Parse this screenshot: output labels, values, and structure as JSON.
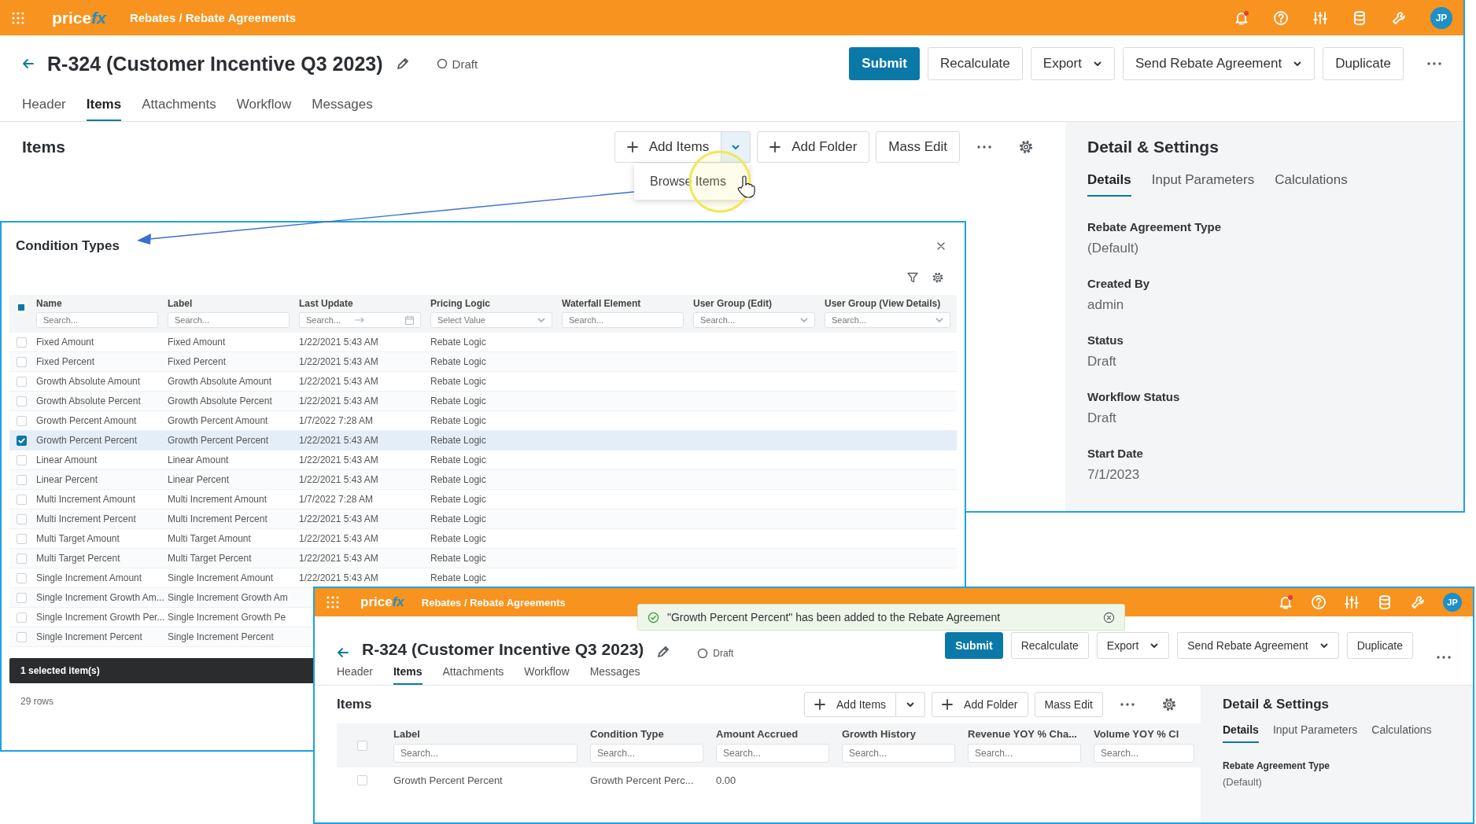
{
  "main": {
    "topbar": {
      "logo": {
        "word": "price",
        "accent": "fx"
      },
      "breadcrumb": "Rebates / Rebate Agreements",
      "notification": true,
      "avatar": "JP"
    },
    "header": {
      "title": "R-324 (Customer Incentive Q3 2023)",
      "status": "Draft",
      "actions": [
        {
          "label": "Submit",
          "kind": "primary"
        },
        {
          "label": "Recalculate",
          "kind": "plain"
        },
        {
          "label": "Export",
          "kind": "menu"
        },
        {
          "label": "Send Rebate Agreement",
          "kind": "menu"
        },
        {
          "label": "Duplicate",
          "kind": "plain"
        }
      ]
    },
    "tabs": [
      {
        "label": "Header",
        "selected": false
      },
      {
        "label": "Items",
        "selected": true
      },
      {
        "label": "Attachments",
        "selected": false
      },
      {
        "label": "Workflow",
        "selected": false
      },
      {
        "label": "Messages",
        "selected": false
      }
    ],
    "items": {
      "title": "Items",
      "toolbar": [
        {
          "label": "Add Items",
          "kind": "split",
          "hovered": true
        },
        {
          "label": "Add Folder",
          "kind": "add"
        },
        {
          "label": "Mass Edit",
          "kind": "plain"
        }
      ],
      "dropdown": [
        "Browse Items"
      ]
    },
    "detail": {
      "title": "Detail & Settings",
      "tabs": [
        {
          "label": "Details",
          "selected": true
        },
        {
          "label": "Input Parameters",
          "selected": false
        },
        {
          "label": "Calculations",
          "selected": false
        }
      ],
      "fields": [
        {
          "label": "Rebate Agreement Type",
          "value": "(Default)"
        },
        {
          "label": "Created By",
          "value": "admin"
        },
        {
          "label": "Status",
          "value": "Draft"
        },
        {
          "label": "Workflow Status",
          "value": "Draft"
        },
        {
          "label": "Start Date",
          "value": "7/1/2023"
        }
      ]
    }
  },
  "condition_types": {
    "title": "Condition Types",
    "select_all_partial": true,
    "columns": [
      {
        "label": "Name",
        "filter": {
          "kind": "text",
          "placeholder": "Search..."
        }
      },
      {
        "label": "Label",
        "filter": {
          "kind": "text",
          "placeholder": "Search..."
        }
      },
      {
        "label": "Last Update",
        "filter": {
          "kind": "date",
          "placeholder": "Search..."
        }
      },
      {
        "label": "Pricing Logic",
        "filter": {
          "kind": "select",
          "placeholder": "Select Value"
        }
      },
      {
        "label": "Waterfall Element",
        "filter": {
          "kind": "text",
          "placeholder": "Search..."
        }
      },
      {
        "label": "User Group (Edit)",
        "filter": {
          "kind": "select",
          "placeholder": "Search..."
        }
      },
      {
        "label": "User Group (View Details)",
        "filter": {
          "kind": "select",
          "placeholder": "Search..."
        }
      }
    ],
    "rows": [
      {
        "selected": false,
        "cells": [
          "Fixed Amount",
          "Fixed Amount",
          "1/22/2021 5:43 AM",
          "Rebate Logic"
        ]
      },
      {
        "selected": false,
        "cells": [
          "Fixed Percent",
          "Fixed Percent",
          "1/22/2021 5:43 AM",
          "Rebate Logic"
        ]
      },
      {
        "selected": false,
        "cells": [
          "Growth Absolute Amount",
          "Growth Absolute Amount",
          "1/22/2021 5:43 AM",
          "Rebate Logic"
        ]
      },
      {
        "selected": false,
        "cells": [
          "Growth Absolute Percent",
          "Growth Absolute Percent",
          "1/22/2021 5:43 AM",
          "Rebate Logic"
        ]
      },
      {
        "selected": false,
        "cells": [
          "Growth Percent Amount",
          "Growth Percent Amount",
          "1/7/2022 7:28 AM",
          "Rebate Logic"
        ]
      },
      {
        "selected": true,
        "cells": [
          "Growth Percent Percent",
          "Growth Percent Percent",
          "1/22/2021 5:43 AM",
          "Rebate Logic"
        ]
      },
      {
        "selected": false,
        "cells": [
          "Linear Amount",
          "Linear Amount",
          "1/22/2021 5:43 AM",
          "Rebate Logic"
        ]
      },
      {
        "selected": false,
        "cells": [
          "Linear Percent",
          "Linear Percent",
          "1/22/2021 5:43 AM",
          "Rebate Logic"
        ]
      },
      {
        "selected": false,
        "cells": [
          "Multi Increment Amount",
          "Multi Increment Amount",
          "1/7/2022 7:28 AM",
          "Rebate Logic"
        ]
      },
      {
        "selected": false,
        "cells": [
          "Multi Increment Percent",
          "Multi Increment Percent",
          "1/22/2021 5:43 AM",
          "Rebate Logic"
        ]
      },
      {
        "selected": false,
        "cells": [
          "Multi Target Amount",
          "Multi Target Amount",
          "1/22/2021 5:43 AM",
          "Rebate Logic"
        ]
      },
      {
        "selected": false,
        "cells": [
          "Multi Target Percent",
          "Multi Target Percent",
          "1/22/2021 5:43 AM",
          "Rebate Logic"
        ]
      },
      {
        "selected": false,
        "cells": [
          "Single Increment Amount",
          "Single Increment Amount",
          "1/22/2021 5:43 AM",
          "Rebate Logic"
        ]
      },
      {
        "selected": false,
        "cells": [
          "Single Increment Growth Am...",
          "Single Increment Growth Am"
        ]
      },
      {
        "selected": false,
        "cells": [
          "Single Increment Growth Per...",
          "Single Increment Growth Pe"
        ]
      },
      {
        "selected": false,
        "cells": [
          "Single Increment Percent",
          "Single Increment Percent"
        ]
      }
    ],
    "selection_bar": "1 selected item(s)",
    "row_count": "29 rows"
  },
  "second_window": {
    "topbar": {
      "logo": {
        "word": "price",
        "accent": "fx"
      },
      "breadcrumb": "Rebates / Rebate Agreements",
      "notification": true,
      "avatar": "JP"
    },
    "toast": {
      "message": "\"Growth Percent Percent\" has been added to the Rebate Agreement"
    },
    "header": {
      "title": "R-324 (Customer Incentive Q3 2023)",
      "status": "Draft",
      "actions": [
        {
          "label": "Submit",
          "kind": "primary"
        },
        {
          "label": "Recalculate",
          "kind": "plain"
        },
        {
          "label": "Export",
          "kind": "menu"
        },
        {
          "label": "Send Rebate Agreement",
          "kind": "menu"
        },
        {
          "label": "Duplicate",
          "kind": "plain"
        }
      ]
    },
    "tabs": [
      {
        "label": "Header",
        "selected": false
      },
      {
        "label": "Items",
        "selected": true
      },
      {
        "label": "Attachments",
        "selected": false
      },
      {
        "label": "Workflow",
        "selected": false
      },
      {
        "label": "Messages",
        "selected": false
      }
    ],
    "items": {
      "title": "Items",
      "toolbar": [
        {
          "label": "Add Items",
          "kind": "split",
          "hovered": false
        },
        {
          "label": "Add Folder",
          "kind": "add"
        },
        {
          "label": "Mass Edit",
          "kind": "plain"
        }
      ],
      "select_all_checked": false,
      "columns": [
        {
          "label": "Label",
          "placeholder": "Search..."
        },
        {
          "label": "Condition Type",
          "placeholder": "Search..."
        },
        {
          "label": "Amount Accrued",
          "placeholder": "Search..."
        },
        {
          "label": "Growth History",
          "placeholder": "Search..."
        },
        {
          "label": "Revenue YOY % Cha...",
          "placeholder": "Search..."
        },
        {
          "label": "Volume YOY % Cl",
          "placeholder": "Search..."
        }
      ],
      "rows": [
        {
          "selected": false,
          "cells": [
            "Growth Percent Percent",
            "Growth Percent Perc...",
            "0.00"
          ]
        }
      ]
    },
    "detail": {
      "title": "Detail & Settings",
      "tabs": [
        {
          "label": "Details",
          "selected": true
        },
        {
          "label": "Input Parameters",
          "selected": false
        },
        {
          "label": "Calculations",
          "selected": false
        }
      ],
      "fields": [
        {
          "label": "Rebate Agreement Type",
          "value": "(Default)"
        }
      ]
    }
  }
}
